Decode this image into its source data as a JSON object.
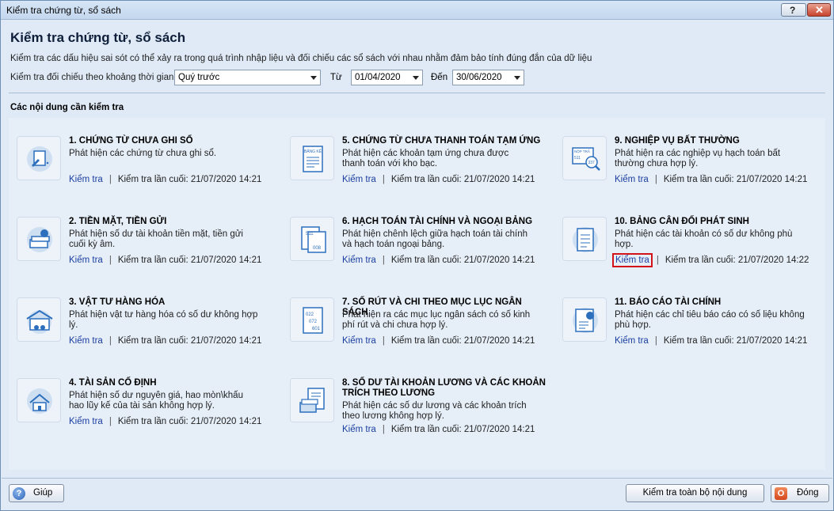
{
  "window": {
    "title": "Kiểm tra chứng từ, sổ sách",
    "help_glyph": "?",
    "close_glyph": "✕"
  },
  "header": {
    "heading": "Kiểm tra chứng từ, sổ sách",
    "description": "Kiểm tra các dấu hiệu sai sót có thể xảy ra trong quá trình nhập liệu và đối chiếu các sổ sách với nhau nhằm đảm bảo tính đúng đắn của dữ liệu"
  },
  "filter": {
    "period_label": "Kiểm tra đối chiếu theo khoảng thời gian",
    "period_value": "Quý trước",
    "from_label": "Từ",
    "from_value": "01/04/2020",
    "to_label": "Đến",
    "to_value": "30/06/2020"
  },
  "section_title": "Các nội dung cần kiểm tra",
  "items": [
    {
      "title": "1. CHỨNG TỪ CHƯA GHI SỔ",
      "desc": "Phát hiện các chứng từ chưa ghi sổ.",
      "link": "Kiểm tra",
      "last": "Kiểm tra lần cuối: 21/07/2020 14:21",
      "icon": "unposted-voucher-icon"
    },
    {
      "title": "2. TIỀN MẶT, TIỀN GỬI",
      "desc": "Phát hiện số dư tài khoản tiền mặt, tiền gửi cuối kỳ âm.",
      "link": "Kiểm tra",
      "last": "Kiểm tra lần cuối: 21/07/2020 14:21",
      "icon": "cash-icon"
    },
    {
      "title": "3. VẬT TƯ HÀNG HÓA",
      "desc": "Phát hiện vật tư hàng hóa có số dư không hợp lý.",
      "link": "Kiểm tra",
      "last": "Kiểm tra lần cuối: 21/07/2020 14:21",
      "icon": "warehouse-icon"
    },
    {
      "title": "4. TÀI SẢN CỐ ĐỊNH",
      "desc": "Phát hiện số dư nguyên giá, hao mòn\\khấu hao lũy kế của tài sản không hợp lý.",
      "link": "Kiểm tra",
      "last": "Kiểm tra lần cuối: 21/07/2020 14:21",
      "icon": "fixed-asset-icon"
    },
    {
      "title": "5. CHỨNG TỪ CHƯA THANH TOÁN TẠM ỨNG",
      "desc": "Phát hiện các khoản tạm ứng chưa được thanh toán với kho bạc.",
      "link": "Kiểm tra",
      "last": "Kiểm tra lần cuối: 21/07/2020 14:21",
      "icon": "advance-voucher-icon",
      "icon_text": "BẢNG KÊ"
    },
    {
      "title": "6. HẠCH TOÁN TÀI CHÍNH VÀ NGOẠI BẢNG",
      "desc": "Phát hiện chênh lệch giữa hạch toán tài chính và hạch toán ngoại bảng.",
      "link": "Kiểm tra",
      "last": "Kiểm tra lần cuối: 21/07/2020 14:21",
      "icon": "ledger-compare-icon",
      "icon_text_a": "511",
      "icon_text_b": "008"
    },
    {
      "title": "7. SỐ RÚT VÀ CHI THEO MỤC LỤC NGÂN SÁCH",
      "desc": "Phát hiện ra các mục lục ngân sách có số kinh phí rút và chi chưa hợp lý.",
      "link": "Kiểm tra",
      "last": "Kiểm tra lần cuối: 21/07/2020 14:21",
      "icon": "budget-index-icon",
      "icon_text_a": "022",
      "icon_text_b": "072",
      "icon_text_c": "601"
    },
    {
      "title": "8. SỐ DƯ TÀI KHOẢN LƯƠNG VÀ CÁC KHOẢN TRÍCH THEO LƯƠNG",
      "desc": "Phát hiện các số dư lương và các khoản trích theo lương không hợp lý.",
      "link": "Kiểm tra",
      "last": "Kiểm tra lần cuối: 21/07/2020 14:21",
      "icon": "salary-icon"
    },
    {
      "title": "9. NGHIỆP VỤ BẤT THƯỜNG",
      "desc": "Phát hiện ra các nghiệp vụ hạch toán bất thường chưa hợp lý.",
      "link": "Kiểm tra",
      "last": "Kiểm tra lần cuối: 21/07/2020 14:21",
      "icon": "unusual-transaction-icon",
      "icon_text_a": "NỘP TRẢ",
      "icon_text_b": "511",
      "icon_text_c": "337"
    },
    {
      "title": "10. BẢNG CÂN ĐỐI PHÁT SINH",
      "desc": "Phát hiện các tài khoản có số dư không phù hợp.",
      "link": "Kiểm tra",
      "last": "Kiểm tra lần cuối: 21/07/2020 14:22",
      "icon": "trial-balance-icon"
    },
    {
      "title": "11. BÁO CÁO TÀI CHÍNH",
      "desc": "Phát hiện các chỉ tiêu báo cáo có số liệu không phù hợp.",
      "link": "Kiểm tra",
      "last": "Kiểm tra lần cuối: 21/07/2020 14:21",
      "icon": "financial-report-icon"
    }
  ],
  "buttons": {
    "help": "Giúp",
    "help_glyph": "?",
    "check_all": "Kiểm tra toàn bộ nội dung",
    "close": "Đóng",
    "close_glyph": "O"
  },
  "colors": {
    "link": "#1b3fa0",
    "highlight_box": "#d2141a",
    "icon_blue": "#2c6fbd"
  }
}
